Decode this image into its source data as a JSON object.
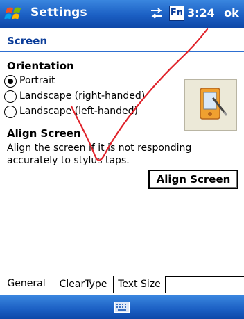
{
  "titlebar": {
    "title": "Settings",
    "fn_label": "Fn",
    "time": "3:24",
    "ok_label": "ok"
  },
  "page": {
    "section_title": "Screen",
    "orientation_heading": "Orientation",
    "options": [
      {
        "label": "Portrait",
        "selected": true
      },
      {
        "label": "Landscape (right-handed)",
        "selected": false
      },
      {
        "label": "Landscape (left-handed)",
        "selected": false
      }
    ],
    "align_heading": "Align Screen",
    "align_description": "Align the screen if it is not responding accurately to stylus taps.",
    "align_button": "Align Screen"
  },
  "tabs": [
    {
      "label": "General",
      "active": true
    },
    {
      "label": "ClearType",
      "active": false
    },
    {
      "label": "Text Size",
      "active": false
    }
  ],
  "icons": {
    "start": "windows-flag-icon",
    "connectivity": "connectivity-arrows-icon",
    "input_panel": "keyboard-icon",
    "illustration": "device-rotation-icon"
  }
}
